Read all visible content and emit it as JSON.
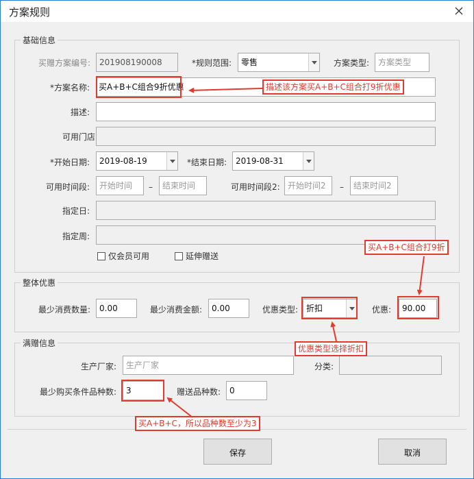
{
  "window": {
    "title": "方案规则"
  },
  "basic": {
    "group_title": "基础信息",
    "scheme_no_label": "买赠方案编号:",
    "scheme_no_value": "201908190008",
    "scope_label": "*规则范围:",
    "scope_value": "零售",
    "type_label": "方案类型:",
    "type_placeholder": "方案类型",
    "name_label": "*方案名称:",
    "name_value": "买A+B+C组合9折优惠",
    "desc_label": "描述:",
    "desc_value": "",
    "stores_label": "可用门店:",
    "start_label": "*开始日期:",
    "start_value": "2019-08-19",
    "end_label": "*结束日期:",
    "end_value": "2019-08-31",
    "period1_label": "可用时间段:",
    "period1_start": "开始时间",
    "period1_end": "结束时间",
    "period2_label": "可用时间段2:",
    "period2_start": "开始时间2",
    "period2_end": "结束时间2",
    "dash": "–",
    "day_label": "指定日:",
    "week_label": "指定周:",
    "member_only_label": "仅会员可用",
    "member_only_checked": false,
    "extend_gift_label": "延伸赠送",
    "extend_gift_checked": false
  },
  "overall": {
    "group_title": "整体优惠",
    "min_qty_label": "最少消费数量:",
    "min_qty_value": "0.00",
    "min_amount_label": "最少消费金额:",
    "min_amount_value": "0.00",
    "discount_type_label": "优惠类型:",
    "discount_type_value": "折扣",
    "discount_label": "优惠:",
    "discount_value": "90.00"
  },
  "gift": {
    "group_title": "满赠信息",
    "maker_label": "生产厂家:",
    "maker_placeholder": "生产厂家",
    "category_label": "分类:",
    "min_kinds_label": "最少购买条件品种数:",
    "min_kinds_value": "3",
    "gift_kinds_label": "赠送品种数:",
    "gift_kinds_value": "0"
  },
  "buttons": {
    "save": "保存",
    "cancel": "取消"
  },
  "annotations": {
    "name_note": "描述该方案买A+B+C组合打9折优惠",
    "discount_note": "买A+B+C组合打9折",
    "type_note": "优惠类型选择折扣",
    "kinds_note": "买A+B+C，所以品种数至少为3"
  },
  "colors": {
    "annotation": "#e23b2e",
    "window_border": "#2b79d8",
    "background": "#f0f0f0"
  }
}
